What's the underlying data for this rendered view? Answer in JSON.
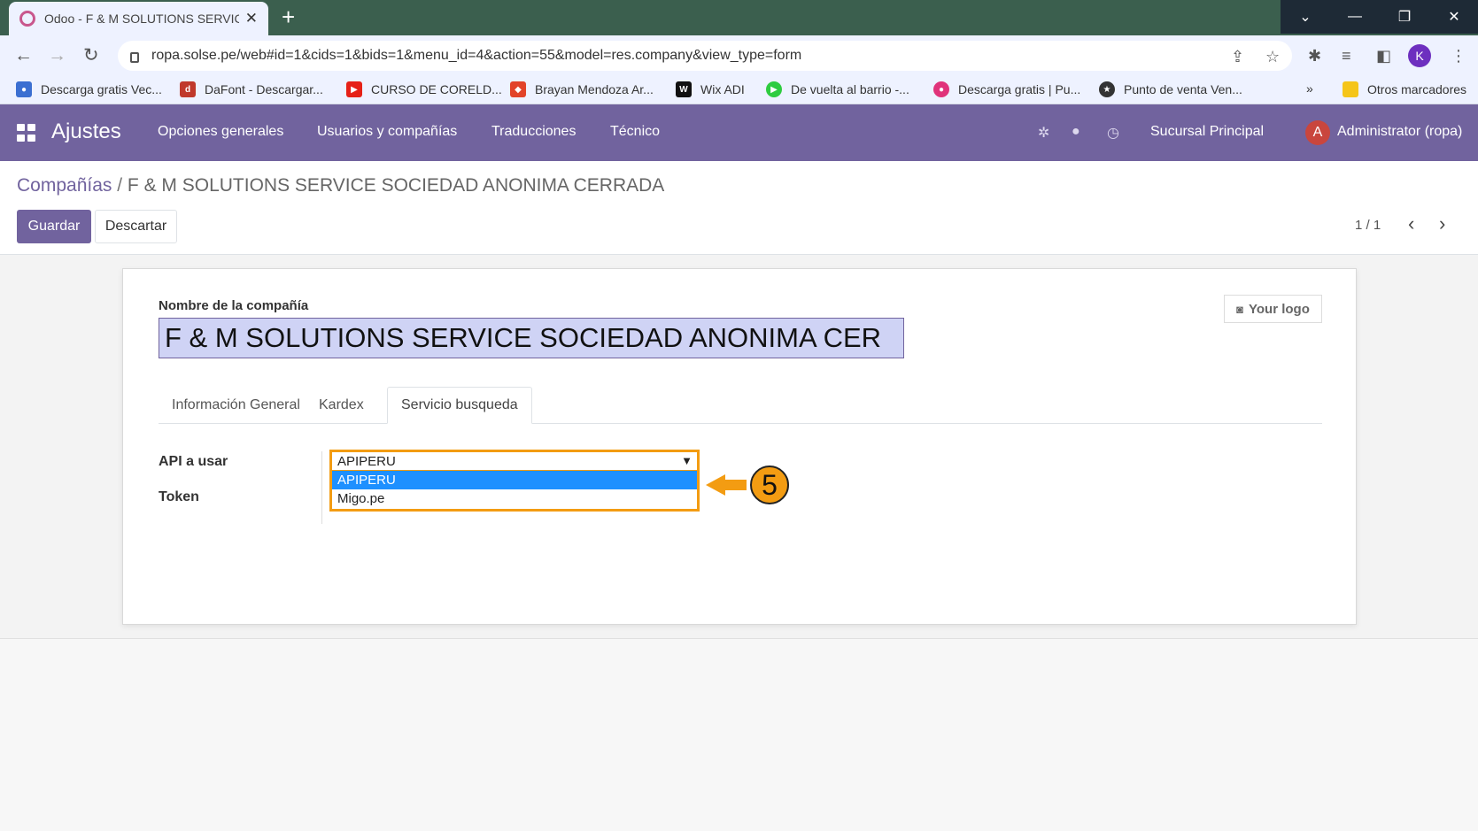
{
  "browser": {
    "tab_title": "Odoo - F & M SOLUTIONS SERVICE",
    "url": "ropa.solse.pe/web#id=1&cids=1&bids=1&menu_id=4&action=55&model=res.company&view_type=form",
    "bookmarks": [
      {
        "label": "Descarga gratis Vec...",
        "icon": "freepik-icon",
        "color": "#3b6fd1"
      },
      {
        "label": "DaFont - Descargar...",
        "icon": "dafont-icon",
        "color": "#c0392b"
      },
      {
        "label": "CURSO DE CORELD...",
        "icon": "youtube-icon",
        "color": "#e62117"
      },
      {
        "label": "Brayan Mendoza Ar...",
        "icon": "gitlab-icon",
        "color": "#e24329"
      },
      {
        "label": "Wix ADI",
        "icon": "wix-icon",
        "color": "#111111"
      },
      {
        "label": "De vuelta al barrio -...",
        "icon": "play-icon",
        "color": "#2ecc40"
      },
      {
        "label": "Descarga gratis | Pu...",
        "icon": "drop-icon",
        "color": "#e0337a"
      },
      {
        "label": "Punto de venta Ven...",
        "icon": "star-badge-icon",
        "color": "#333333"
      }
    ],
    "more_bookmarks": "»",
    "other_bookmarks": "Otros marcadores",
    "profile_initial": "K"
  },
  "navbar": {
    "brand": "Ajustes",
    "menu": [
      "Opciones generales",
      "Usuarios y compañías",
      "Traducciones",
      "Técnico"
    ],
    "company": "Sucursal Principal",
    "user_initial": "A",
    "user": "Administrator (ropa)"
  },
  "control_panel": {
    "breadcrumb_parent": "Compañías",
    "breadcrumb_sep": " / ",
    "breadcrumb_current": "F & M SOLUTIONS SERVICE SOCIEDAD ANONIMA CERRADA",
    "save_label": "Guardar",
    "discard_label": "Descartar",
    "pager": "1 / 1"
  },
  "form": {
    "company_label": "Nombre de la compañía",
    "company_value": "F & M SOLUTIONS SERVICE SOCIEDAD ANONIMA CER",
    "logo_label": "Your logo",
    "tabs": [
      "Información General",
      "Kardex",
      "Servicio busqueda"
    ],
    "active_tab": "Servicio busqueda",
    "api_label": "API a usar",
    "token_label": "Token",
    "api_selected": "APIPERU",
    "api_options": [
      "APIPERU",
      "Migo.pe"
    ]
  },
  "annotation": {
    "step_number": "5",
    "color": "#f39c12"
  }
}
